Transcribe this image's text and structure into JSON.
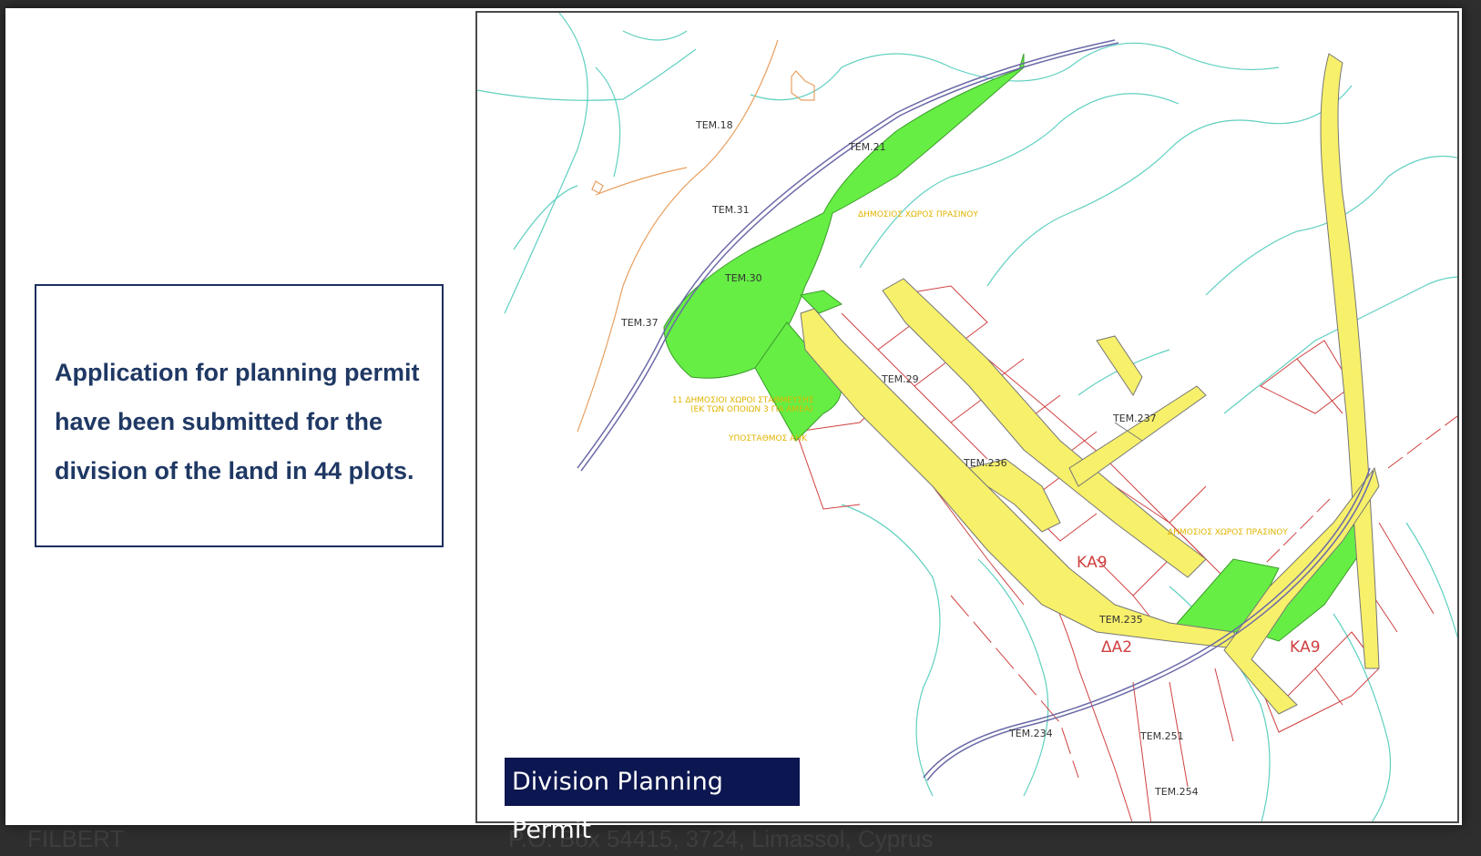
{
  "background": {
    "footer_left": "FILBERT",
    "footer_right": "P.O. Box 54415, 3724, Limassol, Cyprus"
  },
  "callout": {
    "text": "Application for planning permit have been submitted for the division of the land in 44 plots."
  },
  "caption": {
    "text": "Division Planning Permit"
  },
  "map": {
    "labels": {
      "tem18": "TEM.18",
      "tem21": "TEM.21",
      "tem31": "TEM.31",
      "tem30": "TEM.30",
      "tem37": "TEM.37",
      "tem29": "TEM.29",
      "tem237": "TEM.237",
      "tem236": "TEM.236",
      "tem235": "TEM.235",
      "tem234": "TEM.234",
      "tem251": "TEM.251",
      "tem254": "TEM.254",
      "ka9_a": "ΚΑ9",
      "ka9_b": "ΚΑ9",
      "da2": "ΔΑ2",
      "green_space_1": "ΔΗΜΟΣΙΟΣ ΧΩΡΟΣ ΠΡΑΣΙΝΟΥ",
      "green_space_2": "ΔΗΜΟΣΙΟΣ ΧΩΡΟΣ ΠΡΑΣΙΝΟΥ",
      "parking_1": "11 ΔΗΜΟΣΙΟΙ ΧΩΡΟΙ ΣΤΑΘΜΕΥΣΗΣ",
      "parking_2": "(ΕΚ ΤΩΝ ΟΠΟΙΩΝ 3 ΓΙΑ ΑΜΕΑ)",
      "substation": "ΥΠΟΣΤΑΘΜΟΣ ΑΗΚ"
    },
    "colors": {
      "green_area": "#66ee44",
      "road_yellow": "#f7f06a",
      "boundary_red": "#d04040",
      "contour_cyan": "#5fd0c0",
      "contour_orange": "#e8a060",
      "road_outline": "#555555"
    }
  }
}
